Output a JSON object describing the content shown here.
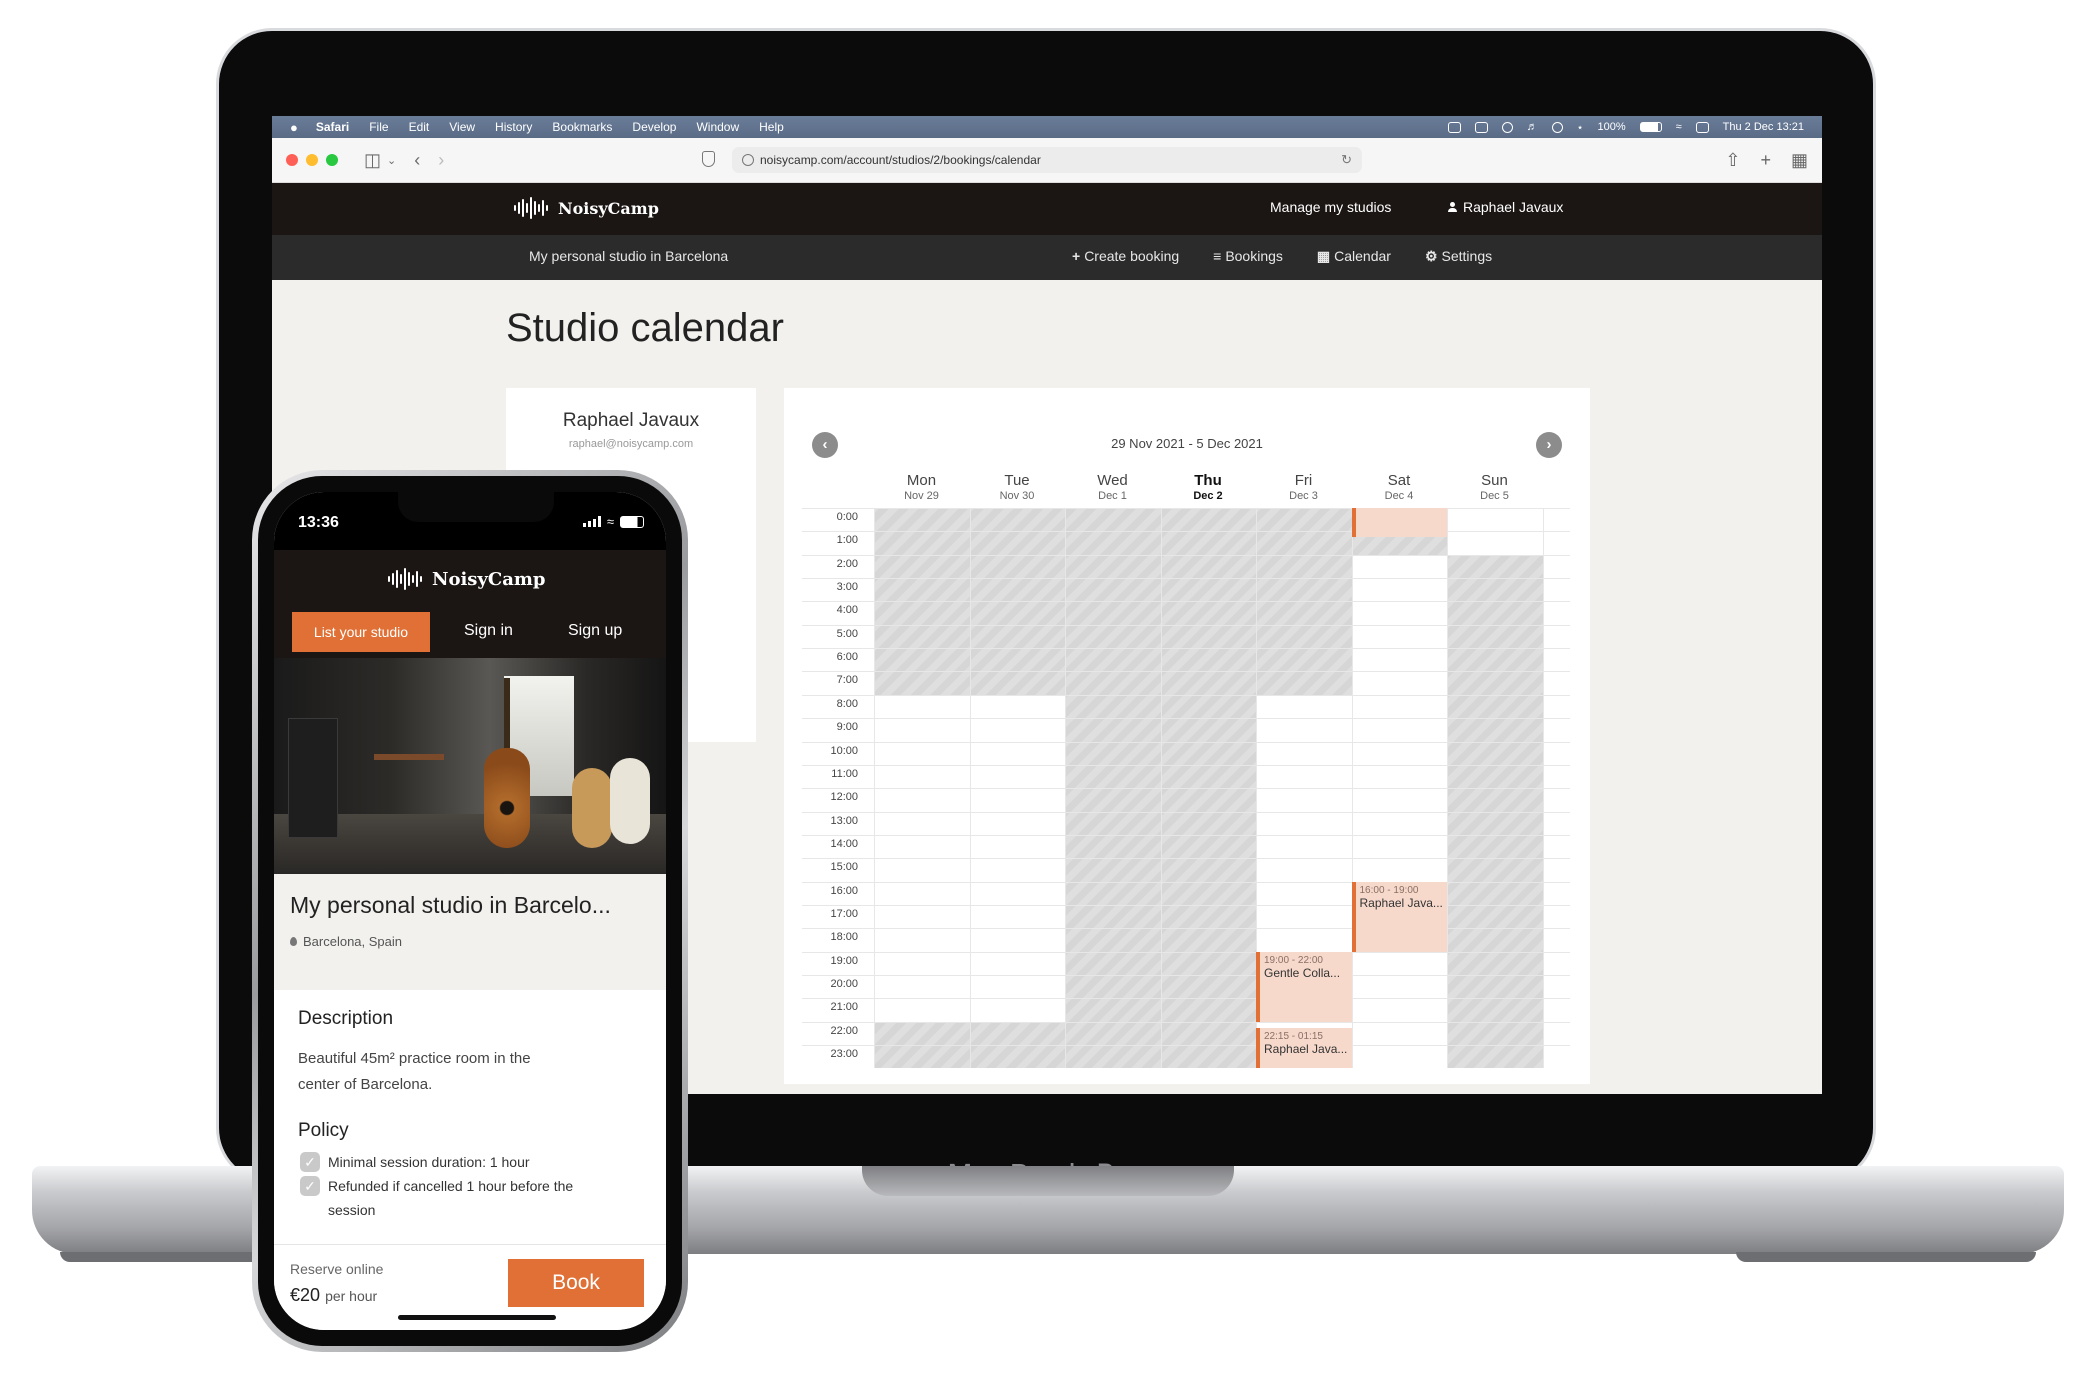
{
  "device_label": "MacBook Pro",
  "mac_menubar": {
    "app": "Safari",
    "items": [
      "File",
      "Edit",
      "View",
      "History",
      "Bookmarks",
      "Develop",
      "Window",
      "Help"
    ],
    "battery": "100%",
    "datetime": "Thu 2 Dec  13:21"
  },
  "browser": {
    "url": "noisycamp.com/account/studios/2/bookings/calendar"
  },
  "site": {
    "logo": "NoisyCamp",
    "manage_link": "Manage my studios",
    "user_menu": "Raphael Javaux",
    "studio_name": "My personal studio in Barcelona",
    "subnav": {
      "create": "Create booking",
      "bookings": "Bookings",
      "calendar": "Calendar",
      "settings": "Settings"
    },
    "page_title": "Studio calendar"
  },
  "user_card": {
    "name": "Raphael Javaux",
    "email": "raphael@noisycamp.com"
  },
  "calendar": {
    "range": "29 Nov 2021 - 5 Dec 2021",
    "days": [
      {
        "name": "Mon",
        "date": "Nov 29"
      },
      {
        "name": "Tue",
        "date": "Nov 30"
      },
      {
        "name": "Wed",
        "date": "Dec 1"
      },
      {
        "name": "Thu",
        "date": "Dec 2"
      },
      {
        "name": "Fri",
        "date": "Dec 3"
      },
      {
        "name": "Sat",
        "date": "Dec 4"
      },
      {
        "name": "Sun",
        "date": "Dec 5"
      }
    ],
    "hours": [
      "0:00",
      "1:00",
      "2:00",
      "3:00",
      "4:00",
      "5:00",
      "6:00",
      "7:00",
      "8:00",
      "9:00",
      "10:00",
      "11:00",
      "12:00",
      "13:00",
      "14:00",
      "15:00",
      "16:00",
      "17:00",
      "18:00",
      "19:00",
      "20:00",
      "21:00",
      "22:00",
      "23:00"
    ],
    "events": [
      {
        "day": 5,
        "start": 0,
        "end": 1.25,
        "time": "",
        "title": ""
      },
      {
        "day": 5,
        "start": 16,
        "end": 19,
        "time": "16:00 - 19:00",
        "title": "Raphael Java..."
      },
      {
        "day": 4,
        "start": 19,
        "end": 22,
        "time": "19:00 - 22:00",
        "title": "Gentle Colla..."
      },
      {
        "day": 4,
        "start": 22.25,
        "end": 24,
        "time": "22:15 - 01:15",
        "title": "Raphael Java..."
      }
    ]
  },
  "phone": {
    "time": "13:36",
    "logo": "NoisyCamp",
    "list_btn": "List your studio",
    "sign_in": "Sign in",
    "sign_up": "Sign up",
    "studio_title": "My personal studio in Barcelo...",
    "location": "Barcelona, Spain",
    "description_heading": "Description",
    "description": "Beautiful 45m² practice room in the center of Barcelona.",
    "policy_heading": "Policy",
    "policies": [
      "Minimal session duration: 1 hour",
      "Refunded if cancelled 1 hour before the session"
    ],
    "reserve": "Reserve online",
    "price": "€20",
    "per": "per hour",
    "book": "Book"
  }
}
